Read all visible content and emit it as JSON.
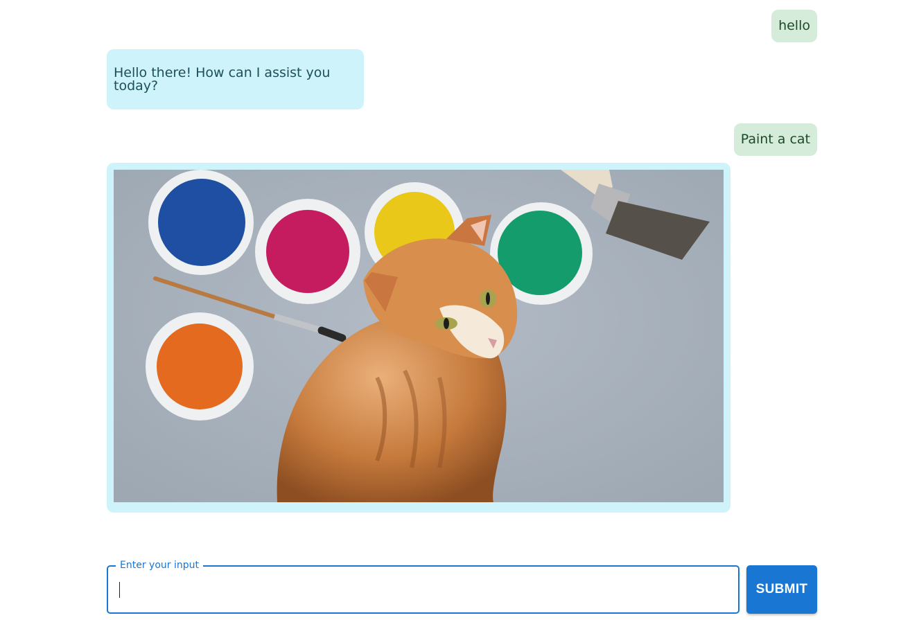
{
  "conversation": {
    "messages": [
      {
        "role": "user",
        "text": "hello"
      },
      {
        "role": "assistant",
        "text": "Hello there! How can I assist you today?"
      },
      {
        "role": "user",
        "text": "Paint a cat"
      },
      {
        "role": "assistant",
        "type": "image",
        "image_subject": "orange tabby cat beside watercolor paint pots and brushes"
      }
    ]
  },
  "composer": {
    "input_label": "Enter your input",
    "input_value": "",
    "submit_label": "SUBMIT"
  },
  "colors": {
    "user_bubble": "#d4ecd9",
    "assistant_bubble": "#cff3fb",
    "accent": "#1976d2"
  }
}
